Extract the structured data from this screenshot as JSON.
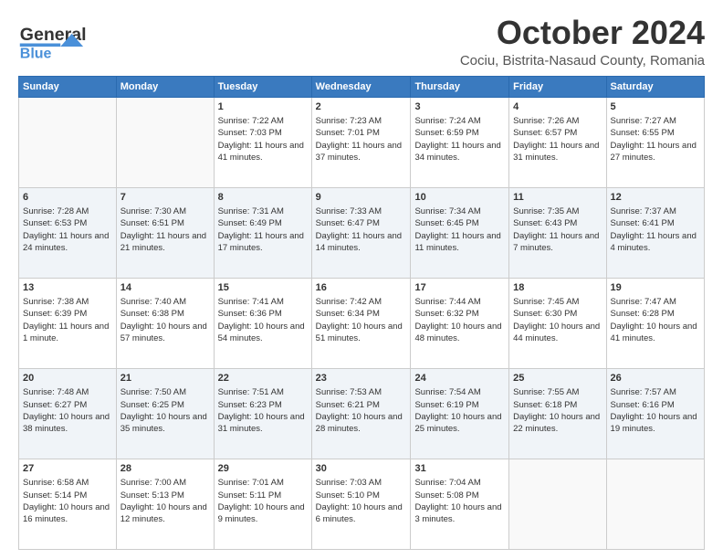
{
  "header": {
    "logo_line1": "General",
    "logo_line2": "Blue",
    "month": "October 2024",
    "location": "Cociu, Bistrita-Nasaud County, Romania"
  },
  "days_header": [
    "Sunday",
    "Monday",
    "Tuesday",
    "Wednesday",
    "Thursday",
    "Friday",
    "Saturday"
  ],
  "weeks": [
    [
      {
        "day": "",
        "sunrise": "",
        "sunset": "",
        "daylight": ""
      },
      {
        "day": "",
        "sunrise": "",
        "sunset": "",
        "daylight": ""
      },
      {
        "day": "1",
        "sunrise": "Sunrise: 7:22 AM",
        "sunset": "Sunset: 7:03 PM",
        "daylight": "Daylight: 11 hours and 41 minutes."
      },
      {
        "day": "2",
        "sunrise": "Sunrise: 7:23 AM",
        "sunset": "Sunset: 7:01 PM",
        "daylight": "Daylight: 11 hours and 37 minutes."
      },
      {
        "day": "3",
        "sunrise": "Sunrise: 7:24 AM",
        "sunset": "Sunset: 6:59 PM",
        "daylight": "Daylight: 11 hours and 34 minutes."
      },
      {
        "day": "4",
        "sunrise": "Sunrise: 7:26 AM",
        "sunset": "Sunset: 6:57 PM",
        "daylight": "Daylight: 11 hours and 31 minutes."
      },
      {
        "day": "5",
        "sunrise": "Sunrise: 7:27 AM",
        "sunset": "Sunset: 6:55 PM",
        "daylight": "Daylight: 11 hours and 27 minutes."
      }
    ],
    [
      {
        "day": "6",
        "sunrise": "Sunrise: 7:28 AM",
        "sunset": "Sunset: 6:53 PM",
        "daylight": "Daylight: 11 hours and 24 minutes."
      },
      {
        "day": "7",
        "sunrise": "Sunrise: 7:30 AM",
        "sunset": "Sunset: 6:51 PM",
        "daylight": "Daylight: 11 hours and 21 minutes."
      },
      {
        "day": "8",
        "sunrise": "Sunrise: 7:31 AM",
        "sunset": "Sunset: 6:49 PM",
        "daylight": "Daylight: 11 hours and 17 minutes."
      },
      {
        "day": "9",
        "sunrise": "Sunrise: 7:33 AM",
        "sunset": "Sunset: 6:47 PM",
        "daylight": "Daylight: 11 hours and 14 minutes."
      },
      {
        "day": "10",
        "sunrise": "Sunrise: 7:34 AM",
        "sunset": "Sunset: 6:45 PM",
        "daylight": "Daylight: 11 hours and 11 minutes."
      },
      {
        "day": "11",
        "sunrise": "Sunrise: 7:35 AM",
        "sunset": "Sunset: 6:43 PM",
        "daylight": "Daylight: 11 hours and 7 minutes."
      },
      {
        "day": "12",
        "sunrise": "Sunrise: 7:37 AM",
        "sunset": "Sunset: 6:41 PM",
        "daylight": "Daylight: 11 hours and 4 minutes."
      }
    ],
    [
      {
        "day": "13",
        "sunrise": "Sunrise: 7:38 AM",
        "sunset": "Sunset: 6:39 PM",
        "daylight": "Daylight: 11 hours and 1 minute."
      },
      {
        "day": "14",
        "sunrise": "Sunrise: 7:40 AM",
        "sunset": "Sunset: 6:38 PM",
        "daylight": "Daylight: 10 hours and 57 minutes."
      },
      {
        "day": "15",
        "sunrise": "Sunrise: 7:41 AM",
        "sunset": "Sunset: 6:36 PM",
        "daylight": "Daylight: 10 hours and 54 minutes."
      },
      {
        "day": "16",
        "sunrise": "Sunrise: 7:42 AM",
        "sunset": "Sunset: 6:34 PM",
        "daylight": "Daylight: 10 hours and 51 minutes."
      },
      {
        "day": "17",
        "sunrise": "Sunrise: 7:44 AM",
        "sunset": "Sunset: 6:32 PM",
        "daylight": "Daylight: 10 hours and 48 minutes."
      },
      {
        "day": "18",
        "sunrise": "Sunrise: 7:45 AM",
        "sunset": "Sunset: 6:30 PM",
        "daylight": "Daylight: 10 hours and 44 minutes."
      },
      {
        "day": "19",
        "sunrise": "Sunrise: 7:47 AM",
        "sunset": "Sunset: 6:28 PM",
        "daylight": "Daylight: 10 hours and 41 minutes."
      }
    ],
    [
      {
        "day": "20",
        "sunrise": "Sunrise: 7:48 AM",
        "sunset": "Sunset: 6:27 PM",
        "daylight": "Daylight: 10 hours and 38 minutes."
      },
      {
        "day": "21",
        "sunrise": "Sunrise: 7:50 AM",
        "sunset": "Sunset: 6:25 PM",
        "daylight": "Daylight: 10 hours and 35 minutes."
      },
      {
        "day": "22",
        "sunrise": "Sunrise: 7:51 AM",
        "sunset": "Sunset: 6:23 PM",
        "daylight": "Daylight: 10 hours and 31 minutes."
      },
      {
        "day": "23",
        "sunrise": "Sunrise: 7:53 AM",
        "sunset": "Sunset: 6:21 PM",
        "daylight": "Daylight: 10 hours and 28 minutes."
      },
      {
        "day": "24",
        "sunrise": "Sunrise: 7:54 AM",
        "sunset": "Sunset: 6:19 PM",
        "daylight": "Daylight: 10 hours and 25 minutes."
      },
      {
        "day": "25",
        "sunrise": "Sunrise: 7:55 AM",
        "sunset": "Sunset: 6:18 PM",
        "daylight": "Daylight: 10 hours and 22 minutes."
      },
      {
        "day": "26",
        "sunrise": "Sunrise: 7:57 AM",
        "sunset": "Sunset: 6:16 PM",
        "daylight": "Daylight: 10 hours and 19 minutes."
      }
    ],
    [
      {
        "day": "27",
        "sunrise": "Sunrise: 6:58 AM",
        "sunset": "Sunset: 5:14 PM",
        "daylight": "Daylight: 10 hours and 16 minutes."
      },
      {
        "day": "28",
        "sunrise": "Sunrise: 7:00 AM",
        "sunset": "Sunset: 5:13 PM",
        "daylight": "Daylight: 10 hours and 12 minutes."
      },
      {
        "day": "29",
        "sunrise": "Sunrise: 7:01 AM",
        "sunset": "Sunset: 5:11 PM",
        "daylight": "Daylight: 10 hours and 9 minutes."
      },
      {
        "day": "30",
        "sunrise": "Sunrise: 7:03 AM",
        "sunset": "Sunset: 5:10 PM",
        "daylight": "Daylight: 10 hours and 6 minutes."
      },
      {
        "day": "31",
        "sunrise": "Sunrise: 7:04 AM",
        "sunset": "Sunset: 5:08 PM",
        "daylight": "Daylight: 10 hours and 3 minutes."
      },
      {
        "day": "",
        "sunrise": "",
        "sunset": "",
        "daylight": ""
      },
      {
        "day": "",
        "sunrise": "",
        "sunset": "",
        "daylight": ""
      }
    ]
  ]
}
